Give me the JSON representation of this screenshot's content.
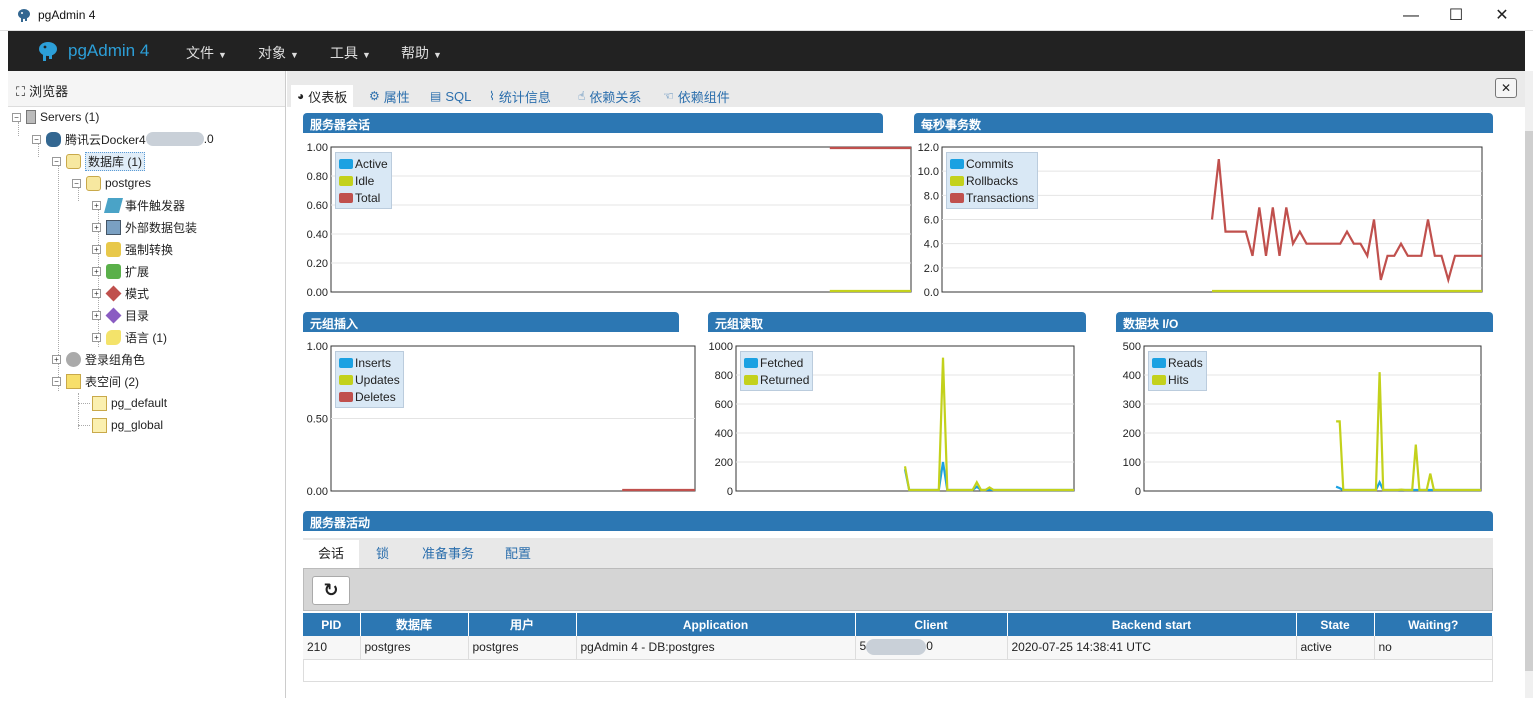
{
  "window": {
    "title": "pgAdmin 4",
    "minimize": "—",
    "maximize": "☐",
    "close": "✕"
  },
  "menubar": {
    "brand": "pgAdmin 4",
    "menus": [
      "文件",
      "对象",
      "工具",
      "帮助"
    ]
  },
  "browser": {
    "title": "浏览器",
    "nodes": {
      "servers": "Servers (1)",
      "server": "腾讯云Docker4",
      "server_suffix": ".0",
      "databases": "数据库 (1)",
      "postgres": "postgres",
      "event_triggers": "事件触发器",
      "foreign_data": "外部数据包装",
      "casts": "强制转换",
      "extensions": "扩展",
      "schemas": "模式",
      "catalogs": "目录",
      "languages": "语言 (1)",
      "login_roles": "登录组角色",
      "tablespaces": "表空间 (2)",
      "pg_default": "pg_default",
      "pg_global": "pg_global"
    }
  },
  "tabs": [
    "仪表板",
    "属性",
    "SQL",
    "统计信息",
    "依赖关系",
    "依赖组件"
  ],
  "panels": {
    "sessions": "服务器会话",
    "tps": "每秒事务数",
    "tuples_in": "元组插入",
    "tuples_out": "元组读取",
    "block_io": "数据块 I/O",
    "activity": "服务器活动"
  },
  "colors": {
    "blue": "#1ba1e2",
    "green": "#c3d11c",
    "red": "#c0504d",
    "header": "#2c77b3"
  },
  "chart_data": [
    {
      "id": "sessions",
      "type": "line",
      "title": "服务器会话",
      "ylim": [
        0,
        1
      ],
      "yticks": [
        "1.00",
        "0.80",
        "0.60",
        "0.40",
        "0.20",
        "0.00"
      ],
      "series": [
        {
          "name": "Active",
          "color": "#1ba1e2",
          "values": []
        },
        {
          "name": "Idle",
          "color": "#c3d11c",
          "values": [
            0,
            0,
            0,
            0,
            0,
            0,
            0,
            0,
            0
          ]
        },
        {
          "name": "Total",
          "color": "#c0504d",
          "values": [
            1,
            1,
            1,
            1,
            1,
            1,
            1,
            1,
            1
          ]
        }
      ],
      "series_start_fraction": 0.86
    },
    {
      "id": "tps",
      "type": "line",
      "title": "每秒事务数",
      "ylim": [
        0,
        12
      ],
      "yticks": [
        "12.0",
        "10.0",
        "8.0",
        "6.0",
        "4.0",
        "2.0",
        "0.0"
      ],
      "series": [
        {
          "name": "Commits",
          "color": "#1ba1e2",
          "values": []
        },
        {
          "name": "Rollbacks",
          "color": "#c3d11c",
          "values": [
            0,
            0,
            0,
            0,
            0,
            0,
            0,
            0,
            0,
            0,
            0,
            0,
            0,
            0,
            0,
            0,
            0,
            0,
            0,
            0,
            0,
            0,
            0,
            0,
            0,
            0,
            0,
            0,
            0,
            0,
            0,
            0,
            0,
            0,
            0,
            0,
            0,
            0,
            0,
            0,
            0
          ]
        },
        {
          "name": "Transactions",
          "color": "#c0504d",
          "values": [
            6,
            11,
            5,
            5,
            5,
            5,
            3,
            7,
            3,
            7,
            3,
            7,
            4,
            5,
            4,
            4,
            4,
            4,
            4,
            4,
            5,
            4,
            4,
            3,
            6,
            1,
            3,
            3,
            4,
            3,
            3,
            3,
            6,
            3,
            3,
            1,
            3,
            3,
            3,
            3,
            3
          ]
        }
      ],
      "series_start_fraction": 0.5
    },
    {
      "id": "tuples_in",
      "type": "line",
      "title": "元组插入",
      "ylim": [
        0,
        1
      ],
      "yticks": [
        "1.00",
        "0.50",
        "0.00"
      ],
      "series": [
        {
          "name": "Inserts",
          "color": "#1ba1e2",
          "values": []
        },
        {
          "name": "Updates",
          "color": "#c3d11c",
          "values": []
        },
        {
          "name": "Deletes",
          "color": "#c0504d",
          "values": [
            0,
            0,
            0,
            0,
            0,
            0
          ]
        }
      ],
      "series_start_fraction": 0.8
    },
    {
      "id": "tuples_out",
      "type": "line",
      "title": "元组读取",
      "ylim": [
        0,
        1000
      ],
      "yticks": [
        "1000",
        "800",
        "600",
        "400",
        "200",
        "0"
      ],
      "series": [
        {
          "name": "Fetched",
          "color": "#1ba1e2",
          "values": [
            150,
            0,
            0,
            0,
            0,
            0,
            0,
            0,
            0,
            200,
            0,
            0,
            0,
            0,
            0,
            0,
            0,
            30,
            0,
            0,
            10,
            0,
            0,
            0,
            0,
            0,
            0,
            0,
            0,
            0,
            0,
            0,
            0,
            0,
            0,
            0,
            0,
            0,
            0,
            0,
            0
          ]
        },
        {
          "name": "Returned",
          "color": "#c3d11c",
          "values": [
            170,
            0,
            0,
            0,
            0,
            0,
            0,
            0,
            0,
            920,
            0,
            0,
            0,
            0,
            0,
            0,
            0,
            60,
            0,
            0,
            25,
            0,
            0,
            0,
            0,
            0,
            0,
            0,
            0,
            0,
            0,
            0,
            0,
            0,
            0,
            0,
            0,
            0,
            0,
            0,
            0
          ]
        }
      ],
      "series_start_fraction": 0.5
    },
    {
      "id": "block_io",
      "type": "line",
      "title": "数据块 I/O",
      "ylim": [
        0,
        500
      ],
      "yticks": [
        "500",
        "400",
        "300",
        "200",
        "100",
        "0"
      ],
      "series": [
        {
          "name": "Reads",
          "color": "#1ba1e2",
          "values": [
            15,
            10,
            0,
            0,
            0,
            0,
            0,
            0,
            0,
            0,
            0,
            0,
            30,
            0,
            0,
            0,
            0,
            0,
            0,
            0,
            0,
            0,
            0,
            0,
            0,
            0,
            0,
            0,
            0,
            0,
            0,
            0,
            0,
            0,
            0,
            0,
            0,
            0,
            0,
            0,
            0
          ]
        },
        {
          "name": "Hits",
          "color": "#c3d11c",
          "values": [
            240,
            240,
            0,
            0,
            0,
            0,
            0,
            0,
            0,
            0,
            0,
            0,
            410,
            0,
            0,
            0,
            0,
            0,
            5,
            0,
            0,
            0,
            160,
            0,
            0,
            0,
            60,
            0,
            0,
            0,
            0,
            0,
            0,
            0,
            0,
            0,
            0,
            0,
            0,
            0,
            0
          ]
        }
      ],
      "series_start_fraction": 0.57
    }
  ],
  "activity": {
    "tabs": [
      "会话",
      "锁",
      "准备事务",
      "配置"
    ],
    "refresh_icon": "↻",
    "columns": [
      "PID",
      "数据库",
      "用户",
      "Application",
      "Client",
      "Backend start",
      "State",
      "Waiting?"
    ],
    "rows": [
      {
        "pid": "210",
        "db": "postgres",
        "user": "postgres",
        "app": "pgAdmin 4 - DB:postgres",
        "client_prefix": "5",
        "client_suffix": "0",
        "backend_start": "2020-07-25 14:38:41 UTC",
        "state": "active",
        "waiting": "no"
      }
    ]
  }
}
